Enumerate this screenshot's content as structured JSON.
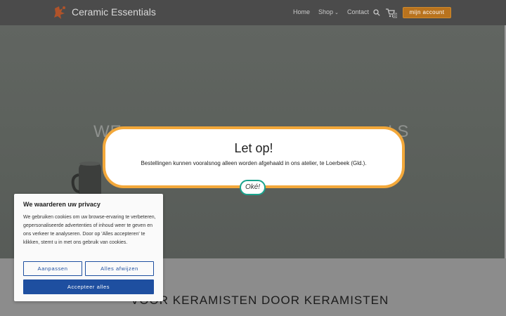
{
  "header": {
    "site_title": "Ceramic Essentials",
    "nav": {
      "home": "Home",
      "shop": "Shop",
      "contact": "Contact"
    },
    "account_label": "mijn account",
    "cart_count": "0"
  },
  "hero": {
    "bg_text_left": "WE",
    "bg_text_right": "LS"
  },
  "section": {
    "heading": "VOOR KERAMISTEN DOOR KERAMISTEN"
  },
  "modal": {
    "title": "Let op!",
    "body": "Bestellingen kunnen vooralsnog alleen worden afgehaald in ons atelier, te Loerbeek (Gld.).",
    "ok_label": "Oké!"
  },
  "cookie": {
    "title": "We waarderen uw privacy",
    "text": "We gebruiken cookies om uw browse-ervaring te verbeteren, gepersonaliseerde advertenties of inhoud weer te geven en ons verkeer te analyseren. Door op 'Alles accepteren' te klikken, stemt u in met ons gebruik van cookies.",
    "customize_label": "Aanpassen",
    "reject_label": "Alles afwijzen",
    "accept_label": "Accepteer alles"
  },
  "colors": {
    "accent_orange": "#f3a83a",
    "account_button": "#b9731e",
    "ok_border": "#1aa38d",
    "cookie_blue": "#1e4fa0"
  }
}
